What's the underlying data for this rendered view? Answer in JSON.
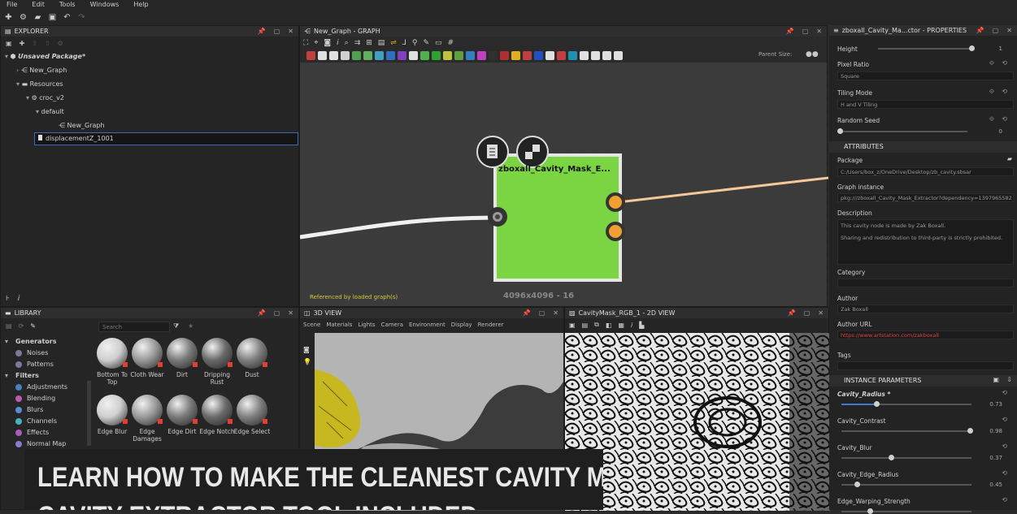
{
  "menu": [
    "File",
    "Edit",
    "Tools",
    "Windows",
    "Help"
  ],
  "explorer": {
    "title": "EXPLORER",
    "package": "Unsaved Package*",
    "graph1": "New_Graph",
    "resources": "Resources",
    "croc": "croc_v2",
    "default": "default",
    "graph2": "New_Graph",
    "selected": "displacementZ_1001"
  },
  "graph": {
    "title": "New_Graph - GRAPH",
    "parent_size_label": "Parent Size:",
    "parent_size_value": "",
    "node_title": "zboxall_Cavity_Mask_E...",
    "referenced": "Referenced by loaded graph(s)",
    "node_footer": "4096x4096 - 16"
  },
  "library": {
    "title": "LIBRARY",
    "search_placeholder": "Search",
    "categories": [
      {
        "label": "Generators",
        "bold": true,
        "color": ""
      },
      {
        "label": "Noises",
        "bold": false,
        "color": "#7a7a9c"
      },
      {
        "label": "Patterns",
        "bold": false,
        "color": "#7a7a9c"
      },
      {
        "label": "Filters",
        "bold": true,
        "color": ""
      },
      {
        "label": "Adjustments",
        "bold": false,
        "color": "#4a7fc0"
      },
      {
        "label": "Blending",
        "bold": false,
        "color": "#c05ab0"
      },
      {
        "label": "Blurs",
        "bold": false,
        "color": "#5a8ad0"
      },
      {
        "label": "Channels",
        "bold": false,
        "color": "#4ab0c0"
      },
      {
        "label": "Effects",
        "bold": false,
        "color": "#b05ac0"
      },
      {
        "label": "Normal Map",
        "bold": false,
        "color": "#8a7ad0"
      }
    ],
    "items_row1": [
      "Bottom To Top",
      "Cloth Wear",
      "Dirt",
      "Dripping Rust",
      "Dust"
    ],
    "items_row2": [
      "Edge Blur",
      "Edge Damages",
      "Edge Dirt",
      "Edge Notch",
      "Edge Select"
    ]
  },
  "view3d": {
    "title": "3D VIEW",
    "menu": [
      "Scene",
      "Materials",
      "Lights",
      "Camera",
      "Environment",
      "Display",
      "Renderer"
    ]
  },
  "view2d": {
    "title": "CavityMask_RGB_1 - 2D VIEW"
  },
  "properties": {
    "title": "zboxall_Cavity_Ma...ctor - PROPERTIES",
    "height_label": "Height",
    "pixel_ratio_label": "Pixel Ratio",
    "pixel_ratio_value": "Square",
    "tiling_label": "Tiling Mode",
    "tiling_value": "H and V Tiling",
    "seed_label": "Random Seed",
    "seed_value": "0",
    "height_value": "1",
    "attributes": "ATTRIBUTES",
    "package_label": "Package",
    "package_value": "C:/Users/box_z/OneDrive/Desktop/zb_cavity.sbsar",
    "instance_label": "Graph instance",
    "instance_value": "pkg:///zboxall_Cavity_Mask_Extractor?dependency=1397965582",
    "desc_label": "Description",
    "desc_line1": "This cavity node is made by Zak Boxall.",
    "desc_line2": "Sharing and redistribution to third-party is strictly prohibited.",
    "category_label": "Category",
    "author_label": "Author",
    "author_value": "Zak Boxall",
    "url_label": "Author URL",
    "url_value": "https://www.artstation.com/zakboxall",
    "tags_label": "Tags",
    "instance_params": "INSTANCE PARAMETERS",
    "params": [
      {
        "label": "Cavity_Radius *",
        "value": "0.73",
        "fraction": 0.25
      },
      {
        "label": "Cavity_Contrast",
        "value": "0.98",
        "fraction": 0.98
      },
      {
        "label": "Cavity_Blur",
        "value": "0.37",
        "fraction": 0.37
      },
      {
        "label": "Cavity_Edge_Radius",
        "value": "0.45",
        "fraction": 0.1
      },
      {
        "label": "Edge_Warping_Strength",
        "value": "",
        "fraction": 0.2
      }
    ]
  },
  "banner": {
    "line1": "LEARN HOW TO MAKE THE CLEANEST CAVITY MAPS",
    "line2": "CAVITY EXTRACTOR TOOL INCLUDED"
  }
}
